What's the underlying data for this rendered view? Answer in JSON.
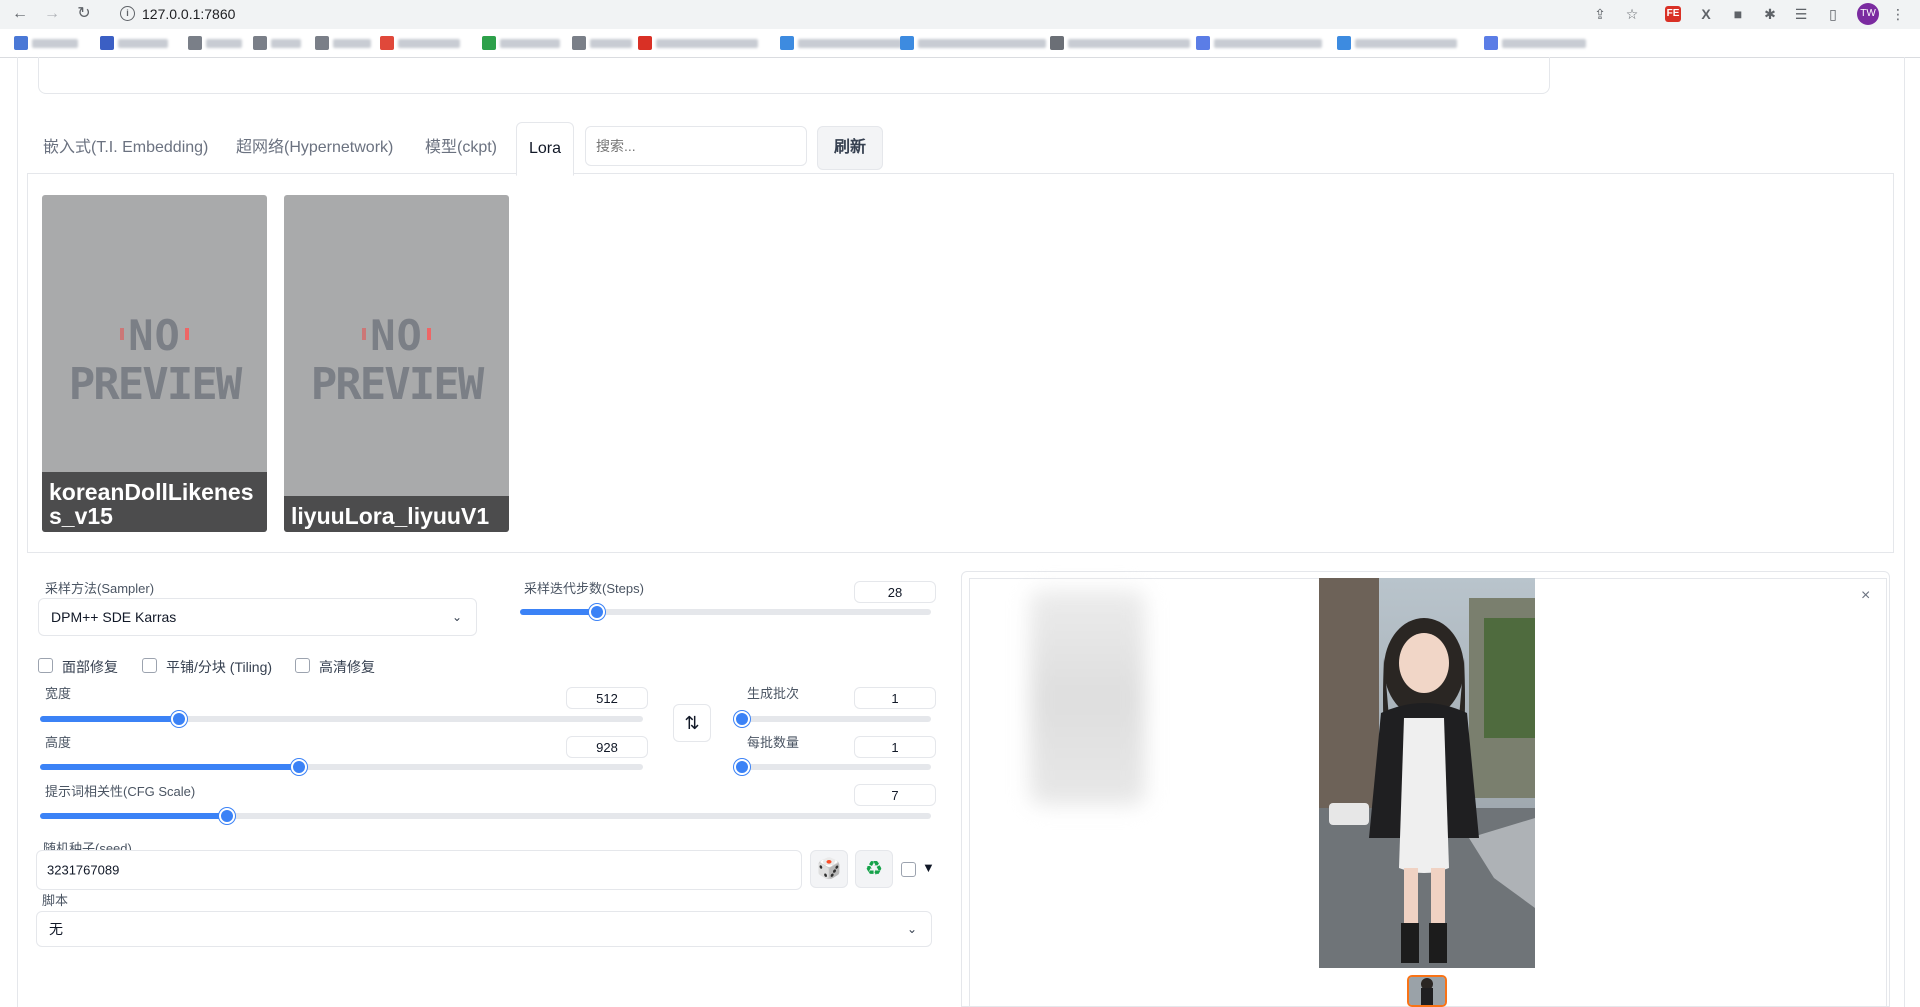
{
  "browser": {
    "url": "127.0.0.1:7860",
    "avatar_initials": "TW",
    "ext_fe": "FE",
    "ext_x": "X",
    "bookmarks_count_note": ""
  },
  "tabs": {
    "items": [
      {
        "label": "嵌入式(T.I. Embedding)"
      },
      {
        "label": "超网络(Hypernetwork)"
      },
      {
        "label": "模型(ckpt)"
      },
      {
        "label": "Lora"
      }
    ],
    "search_placeholder": "搜索...",
    "refresh_label": "刷新"
  },
  "cards": [
    {
      "name": "koreanDollLikeness_v15",
      "preview_line1": "NO",
      "preview_line2": "PREVIEW"
    },
    {
      "name": "liyuuLora_liyuuV1",
      "preview_line1": "NO",
      "preview_line2": "PREVIEW"
    }
  ],
  "settings": {
    "sampler_label": "采样方法(Sampler)",
    "sampler_value": "DPM++ SDE Karras",
    "steps_label": "采样迭代步数(Steps)",
    "steps_value": "28",
    "steps_fraction": 0.187,
    "face_restore_label": "面部修复",
    "tiling_label": "平铺/分块 (Tiling)",
    "hires_label": "高清修复",
    "width_label": "宽度",
    "width_value": "512",
    "width_fraction": 0.23,
    "height_label": "高度",
    "height_value": "928",
    "height_fraction": 0.43,
    "batch_count_label": "生成批次",
    "batch_count_value": "1",
    "batch_size_label": "每批数量",
    "batch_size_value": "1",
    "cfg_label": "提示词相关性(CFG Scale)",
    "cfg_value": "7",
    "cfg_fraction": 0.21,
    "seed_label": "随机种子(seed)",
    "seed_value": "3231767089",
    "script_label": "脚本",
    "script_value": "无"
  },
  "icons": {
    "swap": "⇅",
    "dice": "🎲",
    "recycle": "♻",
    "triangle": "▼",
    "close": "×",
    "chevron": "⌄"
  }
}
